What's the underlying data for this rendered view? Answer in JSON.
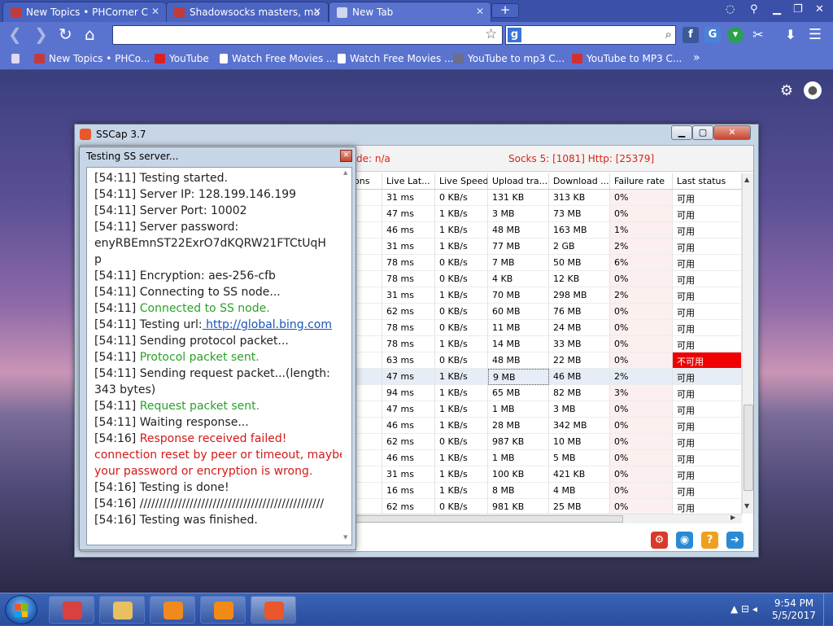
{
  "browser": {
    "tabs": [
      {
        "title": "New Topics • PHCorner C",
        "icon_color": "#c23b3b"
      },
      {
        "title": "Shadowsocks masters, ma",
        "icon_color": "#c23b3b"
      },
      {
        "title": "New Tab",
        "icon_color": "#cfd8f0"
      }
    ],
    "new_tab_label": "+",
    "search_engine_letter": "g",
    "bookmarks": [
      {
        "label": "New Topics • PHCo...",
        "icon_color": "#c23b3b"
      },
      {
        "label": "YouTube",
        "icon_color": "#e02020"
      },
      {
        "label": "Watch Free Movies ...",
        "icon_color": "#ffffff"
      },
      {
        "label": "Watch Free Movies ...",
        "icon_color": "#ffffff"
      },
      {
        "label": "YouTube to mp3 C...",
        "icon_color": "#6d6d8d"
      },
      {
        "label": "YouTube to MP3 C...",
        "icon_color": "#d23030"
      }
    ],
    "bookmarks_more": "»",
    "accent_color": "#5a73cf"
  },
  "sscap": {
    "title": "SSCap 3.7",
    "status_mode": "de: n/a",
    "status_socks": "Socks 5: [1081] Http: [25379]",
    "columns": [
      "ons",
      "Live Lat...",
      "Live Speed",
      "Upload tra...",
      "Download ...",
      "Failure rate",
      "Last status"
    ],
    "rows": [
      [
        "",
        "31 ms",
        "0 KB/s",
        "131 KB",
        "313 KB",
        "0%",
        "可用"
      ],
      [
        "",
        "47 ms",
        "1 KB/s",
        "3 MB",
        "73 MB",
        "0%",
        "可用"
      ],
      [
        "",
        "46 ms",
        "1 KB/s",
        "48 MB",
        "163 MB",
        "1%",
        "可用"
      ],
      [
        "",
        "31 ms",
        "1 KB/s",
        "77 MB",
        "2 GB",
        "2%",
        "可用"
      ],
      [
        "",
        "78 ms",
        "0 KB/s",
        "7 MB",
        "50 MB",
        "6%",
        "可用"
      ],
      [
        "",
        "78 ms",
        "0 KB/s",
        "4 KB",
        "12 KB",
        "0%",
        "可用"
      ],
      [
        "",
        "31 ms",
        "1 KB/s",
        "70 MB",
        "298 MB",
        "2%",
        "可用"
      ],
      [
        "",
        "62 ms",
        "0 KB/s",
        "60 MB",
        "76 MB",
        "0%",
        "可用"
      ],
      [
        "",
        "78 ms",
        "0 KB/s",
        "11 MB",
        "24 MB",
        "0%",
        "可用"
      ],
      [
        "",
        "78 ms",
        "1 KB/s",
        "14 MB",
        "33 MB",
        "0%",
        "可用"
      ],
      [
        "",
        "63 ms",
        "0 KB/s",
        "48 MB",
        "22 MB",
        "0%",
        "不可用"
      ],
      [
        "",
        "47 ms",
        "1 KB/s",
        "9 MB",
        "46 MB",
        "2%",
        "可用"
      ],
      [
        "",
        "94 ms",
        "1 KB/s",
        "65 MB",
        "82 MB",
        "3%",
        "可用"
      ],
      [
        "",
        "47 ms",
        "1 KB/s",
        "1 MB",
        "3 MB",
        "0%",
        "可用"
      ],
      [
        "",
        "46 ms",
        "1 KB/s",
        "28 MB",
        "342 MB",
        "0%",
        "可用"
      ],
      [
        "",
        "62 ms",
        "0 KB/s",
        "987 KB",
        "10 MB",
        "0%",
        "可用"
      ],
      [
        "",
        "46 ms",
        "1 KB/s",
        "1 MB",
        "5 MB",
        "0%",
        "可用"
      ],
      [
        "",
        "31 ms",
        "1 KB/s",
        "100 KB",
        "421 KB",
        "0%",
        "可用"
      ],
      [
        "",
        "16 ms",
        "1 KB/s",
        "8 MB",
        "4 MB",
        "0%",
        "可用"
      ],
      [
        "",
        "62 ms",
        "0 KB/s",
        "981 KB",
        "25 MB",
        "0%",
        "可用"
      ]
    ],
    "bad_status": "不可用",
    "bad_color": "#f00000",
    "bottom_icons": [
      {
        "name": "settings-gear-icon",
        "color": "#d83a2a",
        "glyph": "⚙"
      },
      {
        "name": "globe-icon",
        "color": "#2a8ad4",
        "glyph": "◉"
      },
      {
        "name": "help-icon",
        "color": "#f0a020",
        "glyph": "?"
      },
      {
        "name": "exit-icon",
        "color": "#2a8ad4",
        "glyph": "➔"
      }
    ]
  },
  "dialog": {
    "title": "Testing SS server...",
    "log": [
      {
        "ts": "[54:11]",
        "text": "Testing started.",
        "kind": "normal"
      },
      {
        "ts": "[54:11]",
        "text": "Server IP: 128.199.146.199",
        "kind": "normal"
      },
      {
        "ts": "[54:11]",
        "text": "Server Port: 10002",
        "kind": "normal"
      },
      {
        "ts": "[54:11]",
        "text": "Server password:",
        "kind": "normal"
      },
      {
        "ts": "",
        "text": "enyRBEmnST22ExrO7dKQRW21FTCtUqH",
        "kind": "normal"
      },
      {
        "ts": "",
        "text": "p",
        "kind": "normal"
      },
      {
        "ts": "[54:11]",
        "text": "Encryption: aes-256-cfb",
        "kind": "normal"
      },
      {
        "ts": "[54:11]",
        "text": "Connecting to SS node...",
        "kind": "normal"
      },
      {
        "ts": "[54:11]",
        "text": "Connected to SS node.",
        "kind": "green"
      },
      {
        "ts": "[54:11]",
        "text": "Testing url:",
        "kind": "normal",
        "link": "http://global.bing.com"
      },
      {
        "ts": "[54:11]",
        "text": "Sending protocol packet...",
        "kind": "normal"
      },
      {
        "ts": "[54:11]",
        "text": "Protocol packet sent.",
        "kind": "green"
      },
      {
        "ts": "[54:11]",
        "text": "Sending request packet...(length:",
        "kind": "normal"
      },
      {
        "ts": "",
        "text": "343 bytes)",
        "kind": "normal"
      },
      {
        "ts": "[54:11]",
        "text": "Request packet sent.",
        "kind": "green"
      },
      {
        "ts": "[54:11]",
        "text": "Waiting response...",
        "kind": "normal"
      },
      {
        "ts": "[54:16]",
        "text": "Response received failed!",
        "kind": "red"
      },
      {
        "ts": "",
        "text": "connection reset by peer or timeout, maybe",
        "kind": "red"
      },
      {
        "ts": "",
        "text": "your password or encryption is wrong.",
        "kind": "red"
      },
      {
        "ts": "[54:16]",
        "text": "Testing is done!",
        "kind": "normal"
      },
      {
        "ts": "[54:16]",
        "text": "////////////////////////////////////////////////",
        "kind": "normal"
      },
      {
        "ts": "[54:16]",
        "text": "Testing was finished.",
        "kind": "normal"
      }
    ]
  },
  "taskbar": {
    "time": "9:54 PM",
    "date": "5/5/2017",
    "apps": [
      {
        "name": "taskbar-browser-app",
        "color": "#d94040"
      },
      {
        "name": "taskbar-explorer-app",
        "color": "#e8c060"
      },
      {
        "name": "taskbar-media-player-app",
        "color": "#f08a20"
      },
      {
        "name": "taskbar-vlc-app",
        "color": "#f28a18"
      },
      {
        "name": "taskbar-sscap-app",
        "color": "#e9572b"
      }
    ]
  }
}
